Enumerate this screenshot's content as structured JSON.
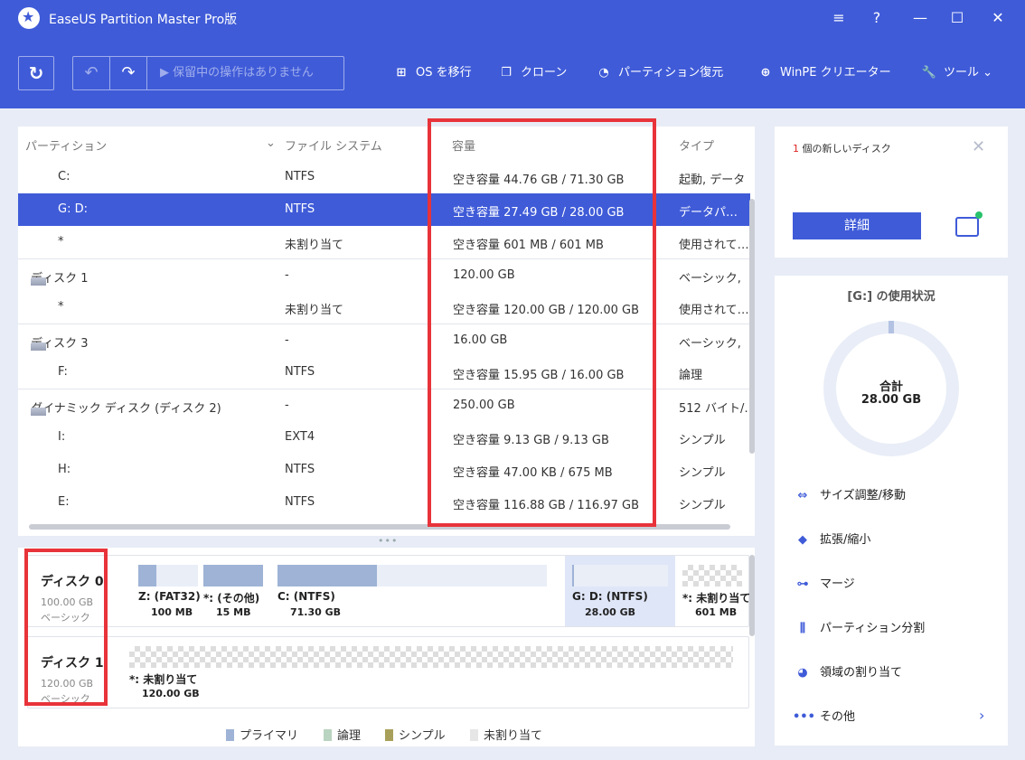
{
  "app": {
    "title": "EaseUS Partition Master Pro版"
  },
  "window_controls": {
    "menu": "≡",
    "help": "?",
    "minimize": "—",
    "maximize": "☐",
    "close": "✕"
  },
  "toolbar": {
    "refresh_icon": "↻",
    "undo_icon": "↶",
    "redo_icon": "↷",
    "pending_label": "▶ 保留中の操作はありません",
    "items": [
      {
        "icon": "⊞",
        "label": "OS を移行"
      },
      {
        "icon": "❐",
        "label": "クローン"
      },
      {
        "icon": "◔",
        "label": "パーティション復元"
      },
      {
        "icon": "⊕",
        "label": "WinPE クリエーター"
      },
      {
        "icon": "🔧",
        "label": "ツール ⌄"
      }
    ]
  },
  "table": {
    "headers": {
      "partition": "パーティション",
      "sort_icon": "⌄",
      "filesystem": "ファイル システム",
      "capacity": "容量",
      "type": "タイプ"
    },
    "rows": [
      {
        "partition": "C:",
        "fs": "NTFS",
        "capacity": "空き容量 44.76 GB / 71.30 GB",
        "type": "起動, データ",
        "disk": false,
        "selected": false
      },
      {
        "partition": "G: D:",
        "fs": "NTFS",
        "capacity": "空き容量 27.49 GB / 28.00 GB",
        "type": "データパ…",
        "disk": false,
        "selected": true
      },
      {
        "partition": "*",
        "fs": "未割り当て",
        "capacity": "空き容量 601 MB / 601 MB",
        "type": "使用されて…",
        "disk": false,
        "selected": false
      },
      {
        "partition": "ディスク 1",
        "fs": "-",
        "capacity": "120.00 GB",
        "type": "ベーシック,",
        "disk": true,
        "selected": false
      },
      {
        "partition": "*",
        "fs": "未割り当て",
        "capacity": "空き容量 120.00 GB / 120.00 GB",
        "type": "使用されて…",
        "disk": false,
        "selected": false
      },
      {
        "partition": "ディスク 3",
        "fs": "-",
        "capacity": "16.00 GB",
        "type": "ベーシック,",
        "disk": true,
        "selected": false
      },
      {
        "partition": "F:",
        "fs": "NTFS",
        "capacity": "空き容量 15.95 GB / 16.00 GB",
        "type": "論理",
        "disk": false,
        "selected": false
      },
      {
        "partition": "ダイナミック ディスク (ディスク 2)",
        "fs": "-",
        "capacity": "250.00 GB",
        "type": "512 バイト/…",
        "disk": true,
        "selected": false
      },
      {
        "partition": "I:",
        "fs": "EXT4",
        "capacity": "空き容量 9.13 GB / 9.13 GB",
        "type": "シンプル",
        "disk": false,
        "selected": false
      },
      {
        "partition": "H:",
        "fs": "NTFS",
        "capacity": "空き容量 47.00 KB / 675 MB",
        "type": "シンプル",
        "disk": false,
        "selected": false
      },
      {
        "partition": "E:",
        "fs": "NTFS",
        "capacity": "空き容量 116.88 GB / 116.97 GB",
        "type": "シンプル",
        "disk": false,
        "selected": false
      }
    ]
  },
  "splitter": {
    "dots": "•••"
  },
  "disk_map": {
    "disks": [
      {
        "name": "ディスク 0",
        "size": "100.00 GB",
        "type": "ベーシック",
        "partitions": [
          {
            "label": "Z: (FAT32)",
            "size": "100 MB",
            "used_fraction": 0.3,
            "unallocated": false,
            "selected": false
          },
          {
            "label": "*: (その他)",
            "size": "15 MB",
            "used_fraction": 1.0,
            "unallocated": false,
            "selected": false
          },
          {
            "label": "C: (NTFS)",
            "size": "71.30 GB",
            "used_fraction": 0.37,
            "unallocated": false,
            "selected": false
          },
          {
            "label": "G: D: (NTFS)",
            "size": "28.00 GB",
            "used_fraction": 0.02,
            "unallocated": false,
            "selected": true
          },
          {
            "label": "*: 未割り当て",
            "size": "601 MB",
            "used_fraction": 0,
            "unallocated": true,
            "selected": false
          }
        ]
      },
      {
        "name": "ディスク 1",
        "size": "120.00 GB",
        "type": "ベーシック",
        "partitions": [
          {
            "label": "*: 未割り当て",
            "size": "120.00 GB",
            "used_fraction": 0,
            "unallocated": true,
            "selected": false
          }
        ]
      }
    ],
    "legend": [
      {
        "label": "プライマリ",
        "color": "#9eb3d6"
      },
      {
        "label": "論理",
        "color": "#b9d4c0"
      },
      {
        "label": "シンプル",
        "color": "#a8a05a"
      },
      {
        "label": "未割り当て",
        "color": "#e6e6e6"
      }
    ]
  },
  "new_disk_card": {
    "count": "1",
    "message": " 個の新しいディスク",
    "close_icon": "✕",
    "detail_button": "詳細",
    "drive_icon": "hdd-icon"
  },
  "usage_card": {
    "title": "[G:] の使用状況",
    "total_label": "合計",
    "total_value": "28.00 GB",
    "used_fraction": 0.02,
    "actions": [
      {
        "icon": "⇔",
        "label": "サイズ調整/移動"
      },
      {
        "icon": "◆",
        "label": "拡張/縮小"
      },
      {
        "icon": "⊶",
        "label": "マージ"
      },
      {
        "icon": "⫼",
        "label": "パーティション分割"
      },
      {
        "icon": "◕",
        "label": "領域の割り当て"
      },
      {
        "icon": "•••",
        "label": "その他",
        "chevron": "›"
      }
    ]
  },
  "colors": {
    "accent": "#3f5bd8",
    "highlight": "#e8333a",
    "background": "#e8ecf6"
  }
}
